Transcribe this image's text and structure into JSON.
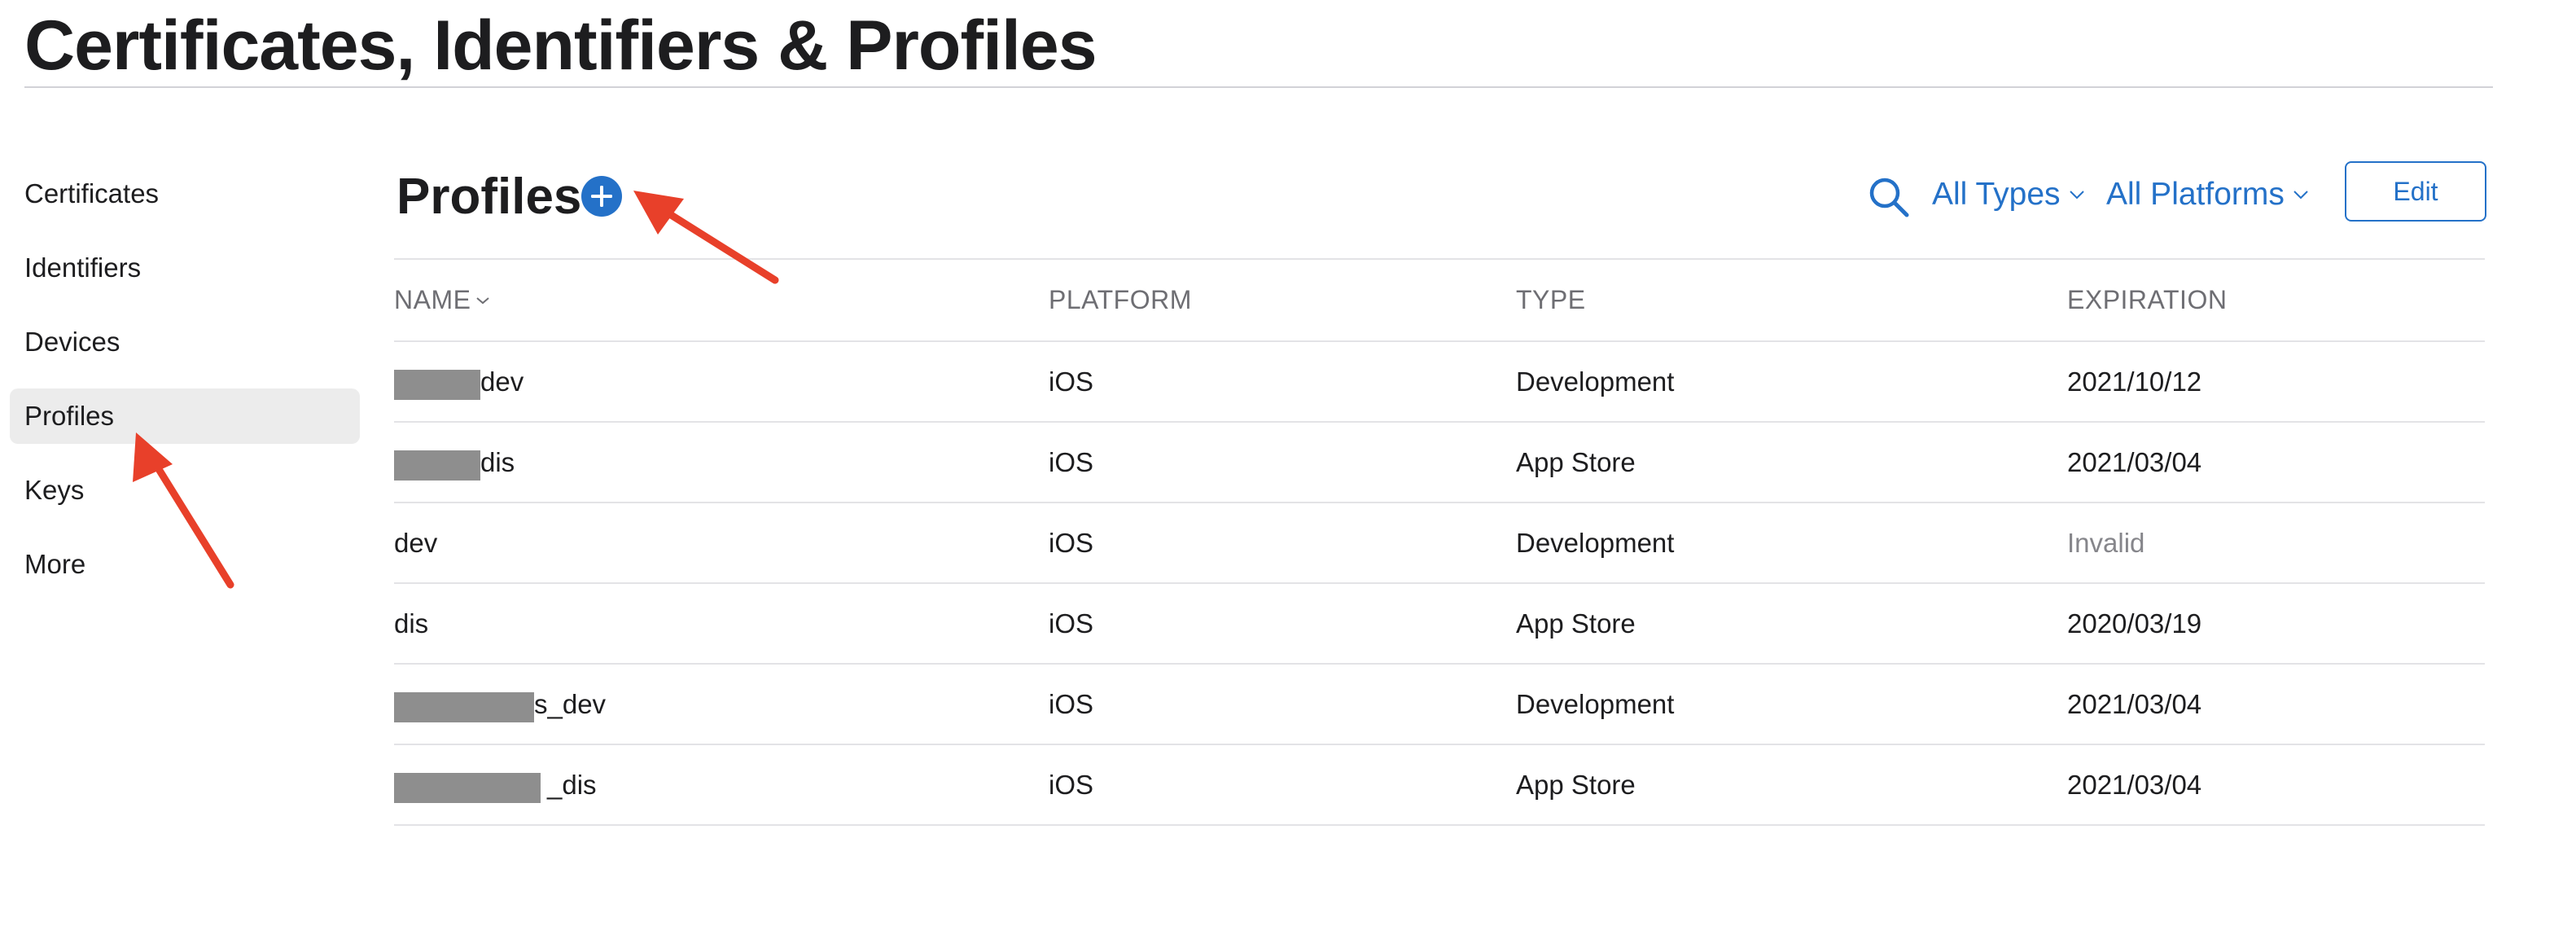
{
  "page_title": "Certificates, Identifiers & Profiles",
  "sidebar": {
    "items": [
      {
        "label": "Certificates",
        "active": false
      },
      {
        "label": "Identifiers",
        "active": false
      },
      {
        "label": "Devices",
        "active": false
      },
      {
        "label": "Profiles",
        "active": true
      },
      {
        "label": "Keys",
        "active": false
      },
      {
        "label": "More",
        "active": false
      }
    ]
  },
  "header": {
    "section_title": "Profiles",
    "add_icon": "plus-circle-icon",
    "search_icon": "search-icon",
    "filter_types": "All Types",
    "filter_platforms": "All Platforms",
    "edit_label": "Edit"
  },
  "table": {
    "columns": [
      "NAME",
      "PLATFORM",
      "TYPE",
      "EXPIRATION"
    ],
    "rows": [
      {
        "name": "dev",
        "platform": "iOS",
        "type": "Development",
        "expiration": "2021/10/12",
        "expiration_invalid": false
      },
      {
        "name": "dis",
        "platform": "iOS",
        "type": "App Store",
        "expiration": "2021/03/04",
        "expiration_invalid": false
      },
      {
        "name": "dev",
        "platform": "iOS",
        "type": "Development",
        "expiration": "Invalid",
        "expiration_invalid": true
      },
      {
        "name": "dis",
        "platform": "iOS",
        "type": "App Store",
        "expiration": "2020/03/19",
        "expiration_invalid": false
      },
      {
        "name": "s_dev",
        "platform": "iOS",
        "type": "Development",
        "expiration": "2021/03/04",
        "expiration_invalid": false
      },
      {
        "name": "_dis",
        "platform": "iOS",
        "type": "App Store",
        "expiration": "2021/03/04",
        "expiration_invalid": false
      }
    ]
  },
  "colors": {
    "accent": "#2471c8",
    "annotation_arrow": "#e8402a",
    "active_sidebar_bg": "#ececec",
    "redaction": "#8e8e8e"
  }
}
